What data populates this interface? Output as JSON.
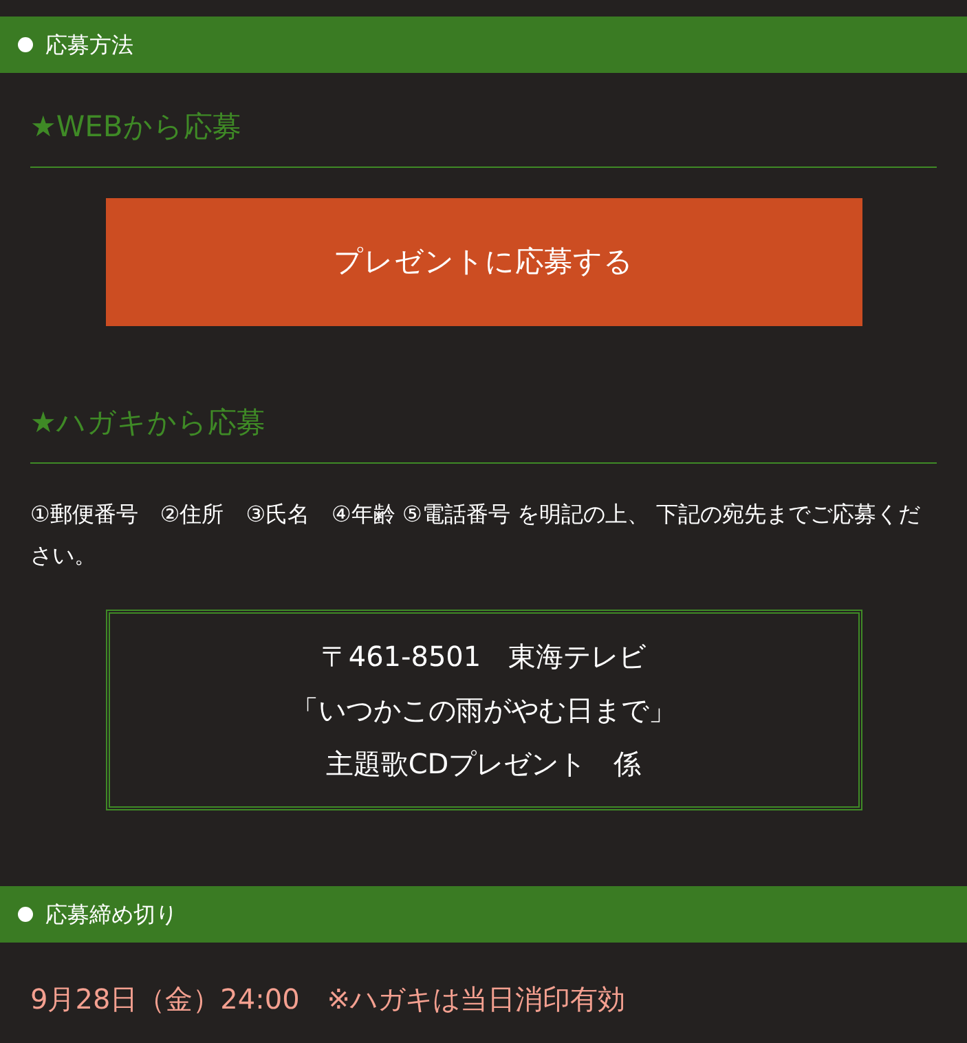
{
  "sections": [
    {
      "title": "応募方法",
      "methods": [
        {
          "kind": "web",
          "heading": "★WEBから応募",
          "button": "プレゼントに応募する"
        },
        {
          "kind": "postcard",
          "heading": "★ハガキから応募",
          "instructions": "①郵便番号　②住所　③氏名　④年齢 ⑤電話番号 を明記の上、 下記の宛先までご応募ください。",
          "address_lines": [
            "〒461-8501　東海テレビ",
            "「いつかこの雨がやむ日まで」",
            "主題歌CDプレゼント　係"
          ]
        }
      ]
    },
    {
      "title": "応募締め切り",
      "deadline": "9月28日（金）24:00　※ハガキは当日消印有効"
    }
  ]
}
